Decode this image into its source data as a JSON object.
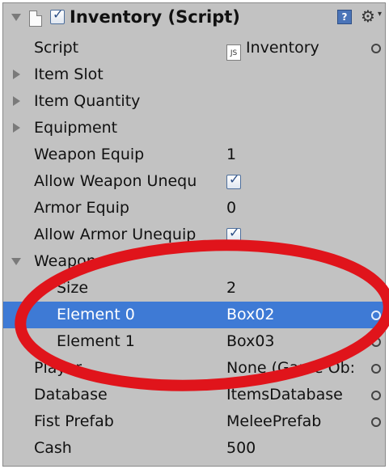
{
  "component": {
    "title": "Inventory (Script)",
    "help_glyph": "?",
    "gear_caret": "▾"
  },
  "rows": [
    {
      "label": "Script",
      "value": "Inventory"
    },
    {
      "label": "Item Slot"
    },
    {
      "label": "Item Quantity"
    },
    {
      "label": "Equipment"
    },
    {
      "label": "Weapon Equip",
      "value": "1"
    },
    {
      "label": "Allow Weapon Unequ",
      "checked": true
    },
    {
      "label": "Armor Equip",
      "value": "0"
    },
    {
      "label": "Allow Armor Unequip",
      "checked": true
    },
    {
      "label": "Weapon"
    },
    {
      "label": "Size",
      "value": "2"
    },
    {
      "label": "Element 0",
      "value": "Box02",
      "selected": true
    },
    {
      "label": "Element 1",
      "value": "Box03"
    },
    {
      "label": "Player",
      "value": "None (Game Ob:"
    },
    {
      "label": "Database",
      "value": "ItemsDatabase"
    },
    {
      "label": "Fist Prefab",
      "value": "MeleePrefab"
    },
    {
      "label": "Cash",
      "value": "500"
    }
  ],
  "js_icon_text": "JS",
  "annotation": {
    "color": "#e0141b",
    "shape": "ellipse"
  },
  "colors": {
    "panel_bg": "#c2c2c2",
    "selected_bg": "#3e7ad5"
  }
}
